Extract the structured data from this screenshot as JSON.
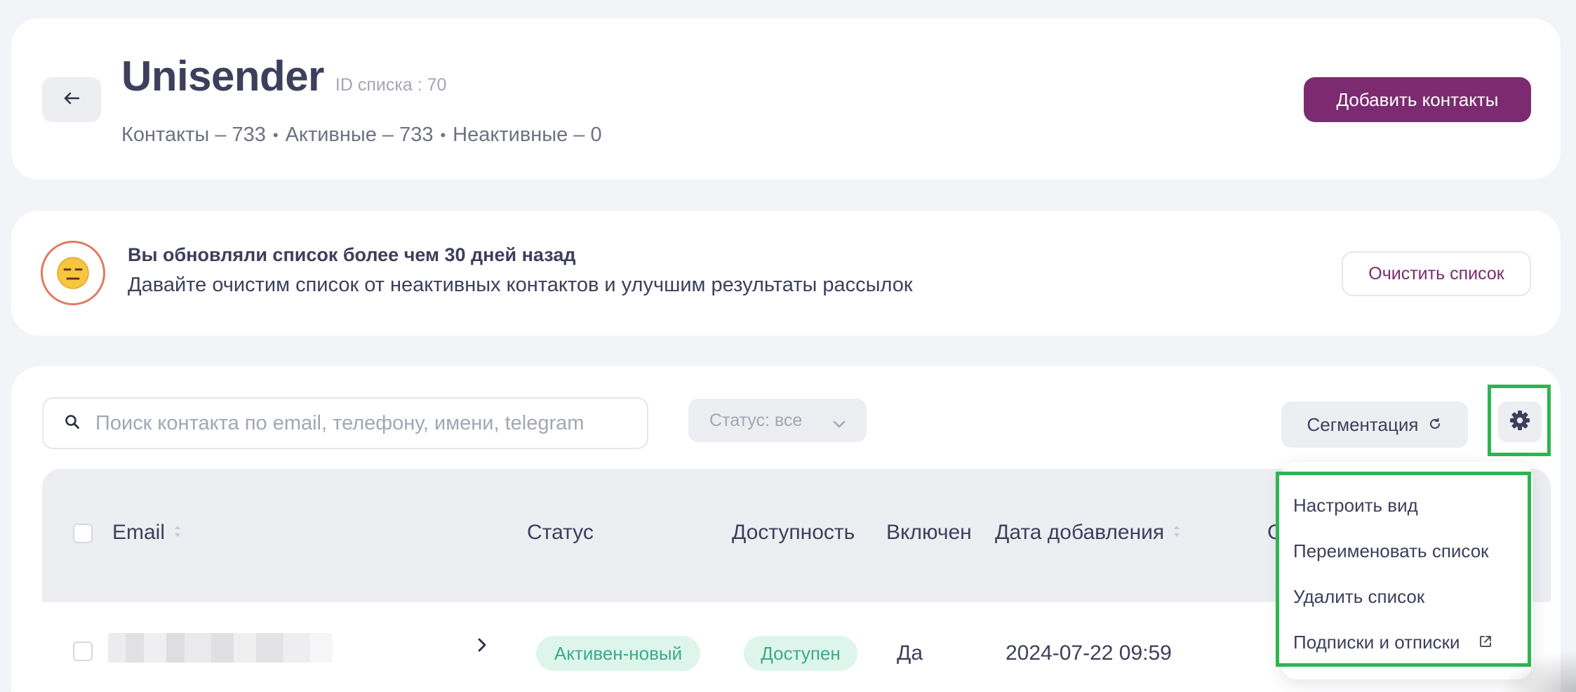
{
  "header": {
    "title": "Unisender",
    "list_id": "ID списка : 70",
    "stats": {
      "contacts": "Контакты – 733",
      "active": "Активные – 733",
      "inactive": "Неактивные – 0",
      "separator": "•"
    },
    "add_contacts_label": "Добавить контакты"
  },
  "notice": {
    "emoji": "😑",
    "title": "Вы обновляли список более чем 30 дней назад",
    "text": "Давайте очистим список от неактивных контактов и улучшим результаты рассылок",
    "clean_label": "Очистить список"
  },
  "toolbar": {
    "search_placeholder": "Поиск контакта по email, телефону, имени, telegram",
    "status_filter_label": "Статус: все",
    "segmentation_label": "Сегментация"
  },
  "table": {
    "columns": {
      "email": "Email",
      "status": "Статус",
      "availability": "Доступность",
      "enabled": "Включен",
      "date_added": "Дата добавления",
      "partial": "Сп"
    },
    "rows": [
      {
        "status": "Активен-новый",
        "availability": "Доступен",
        "enabled": "Да",
        "date_added": "2024-07-22 09:59"
      }
    ]
  },
  "settings_menu": {
    "items": [
      "Настроить вид",
      "Переименовать список",
      "Удалить список",
      "Подписки и отписки"
    ]
  },
  "colors": {
    "brand": "#7c2b70",
    "highlight": "#2db64f",
    "badge_bg": "#def5ec",
    "badge_text": "#3aa98a"
  }
}
